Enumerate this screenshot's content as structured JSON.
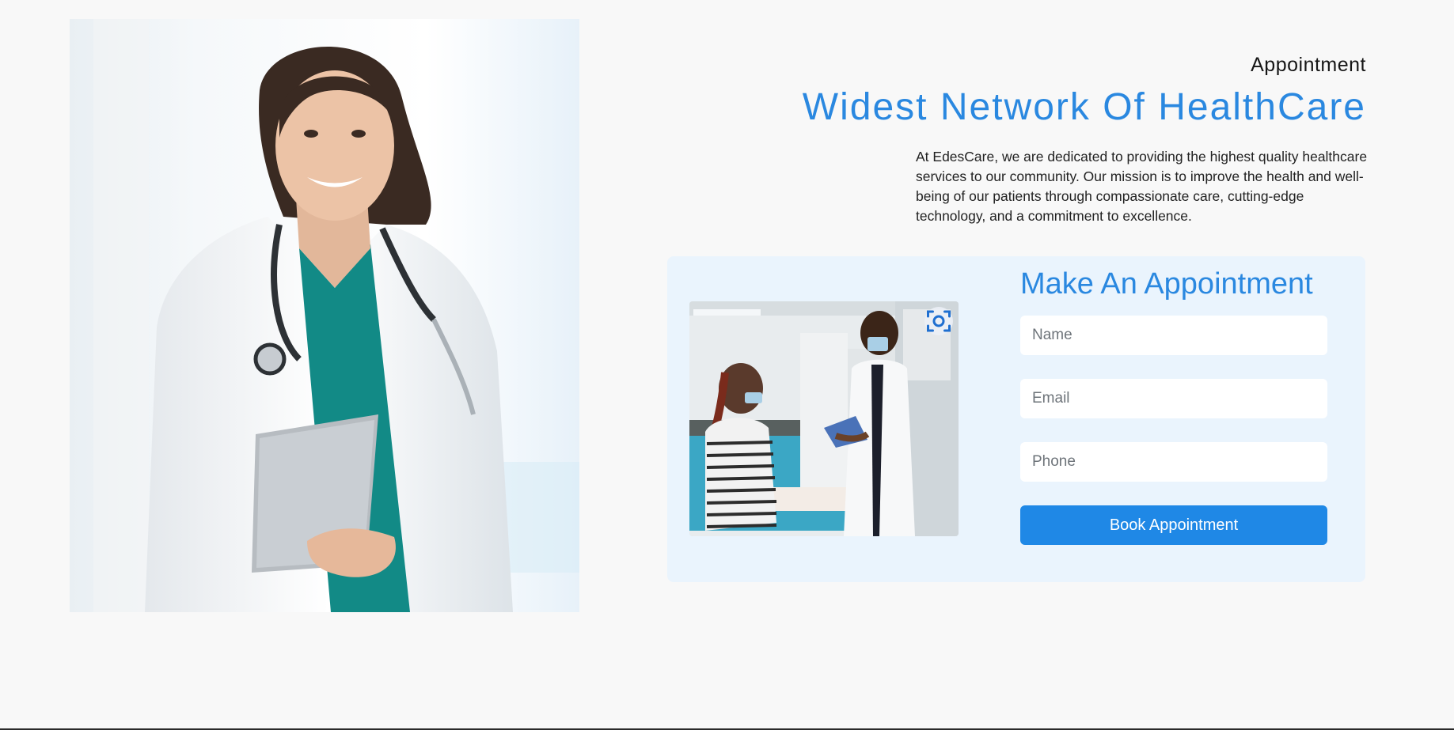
{
  "section": {
    "eyebrow": "Appointment",
    "headline": "Widest Network Of HealthCare",
    "intro": "At EdesCare, we are dedicated to providing the highest quality healthcare services to our community. Our mission is to improve the health and well-being of our patients through compassionate care, cutting-edge technology, and a commitment to excellence."
  },
  "form": {
    "title": "Make An Appointment",
    "name_placeholder": "Name",
    "email_placeholder": "Email",
    "phone_placeholder": "Phone",
    "submit_label": "Book Appointment"
  },
  "icons": {
    "scan": "visual-search-icon"
  },
  "colors": {
    "accent": "#2a88e0",
    "button": "#1f88e6",
    "card_bg": "#eaf4fd",
    "page_bg": "#f8f8f8"
  }
}
